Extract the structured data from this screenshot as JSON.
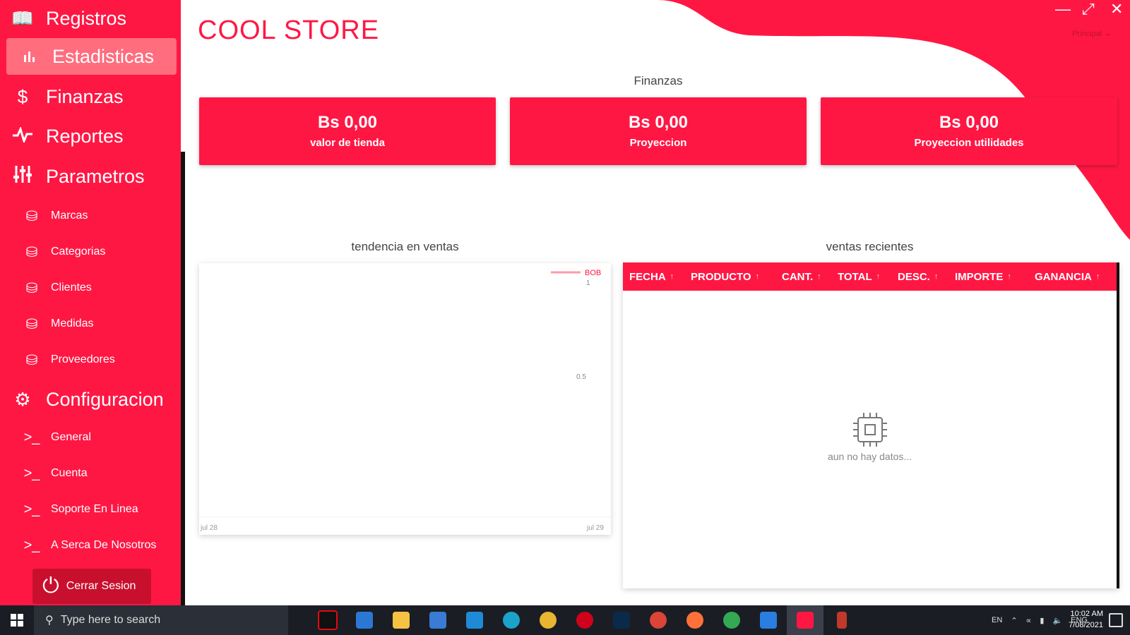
{
  "app": {
    "title": "COOL STORE",
    "principal": "Principal"
  },
  "sidebar": {
    "main_items": [
      {
        "label": "Registros",
        "icon": "book-icon"
      },
      {
        "label": "Estadisticas",
        "icon": "bar-chart-icon"
      },
      {
        "label": "Finanzas",
        "icon": "dollar-icon"
      },
      {
        "label": "Reportes",
        "icon": "pulse-icon"
      },
      {
        "label": "Parametros",
        "icon": "sliders-icon"
      }
    ],
    "param_items": [
      "Marcas",
      "Categorias",
      "Clientes",
      "Medidas",
      "Proveedores"
    ],
    "config_label": "Configuracion",
    "config_items": [
      "General",
      "Cuenta",
      "Soporte En Linea",
      "A Serca De Nosotros"
    ],
    "logout_label": "Cerrar Sesion"
  },
  "finanzas": {
    "title": "Finanzas",
    "cards": [
      {
        "amount": "Bs 0,00",
        "label": "valor de tienda"
      },
      {
        "amount": "Bs 0,00",
        "label": "Proyeccion"
      },
      {
        "amount": "Bs 0,00",
        "label": "Proyeccion utilidades"
      }
    ]
  },
  "chart": {
    "title": "tendencia en ventas",
    "legend": "BOB",
    "y_ticks": [
      "1",
      "0.5"
    ],
    "x_ticks": [
      "jul 28",
      "jul 29"
    ]
  },
  "chart_data": {
    "type": "line",
    "title": "tendencia en ventas",
    "series": [
      {
        "name": "BOB",
        "values": []
      }
    ],
    "x": [
      "jul 28",
      "jul 29"
    ],
    "y_ticks": [
      1,
      0.5
    ],
    "legend_position": "top-right"
  },
  "table": {
    "title": "ventas recientes",
    "columns": [
      "FECHA",
      "PRODUCTO",
      "CANT.",
      "TOTAL",
      "DESC.",
      "IMPORTE",
      "GANANCIA"
    ],
    "empty_text": "aun no hay datos..."
  },
  "taskbar": {
    "search_placeholder": "Type here to search",
    "lang": "EN",
    "keyboard": "ENG",
    "time": "10:02 AM",
    "date": "7/08/2021"
  },
  "colors": {
    "accent": "#ff1744",
    "accent_light": "#ff6d7e",
    "dark_accent": "#c8102e"
  }
}
